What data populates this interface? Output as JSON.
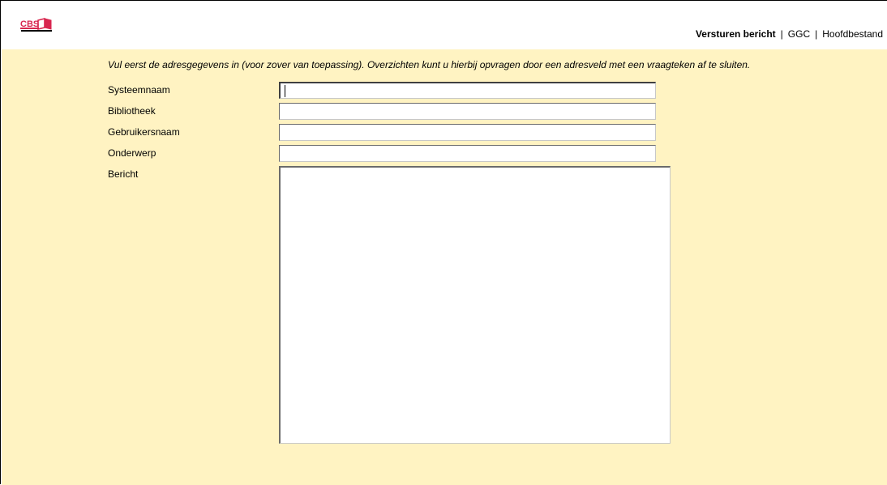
{
  "header": {
    "logo_text": "CBS",
    "nav": [
      {
        "label": "Versturen bericht",
        "active": true
      },
      {
        "label": "GGC",
        "active": false
      },
      {
        "label": "Hoofdbestand",
        "active": false
      }
    ],
    "separator": "|"
  },
  "form": {
    "intro": "Vul eerst de adresgegevens in (voor zover van toepassing). Overzichten kunt u hierbij opvragen door een adresveld met een vraagteken af te sluiten.",
    "fields": [
      {
        "label": "Systeemnaam",
        "value": ""
      },
      {
        "label": "Bibliotheek",
        "value": ""
      },
      {
        "label": "Gebruikersnaam",
        "value": ""
      },
      {
        "label": "Onderwerp",
        "value": ""
      }
    ],
    "message": {
      "label": "Bericht",
      "value": ""
    }
  },
  "colors": {
    "content_background": "#fff3c2",
    "logo_accent": "#d8264f"
  }
}
